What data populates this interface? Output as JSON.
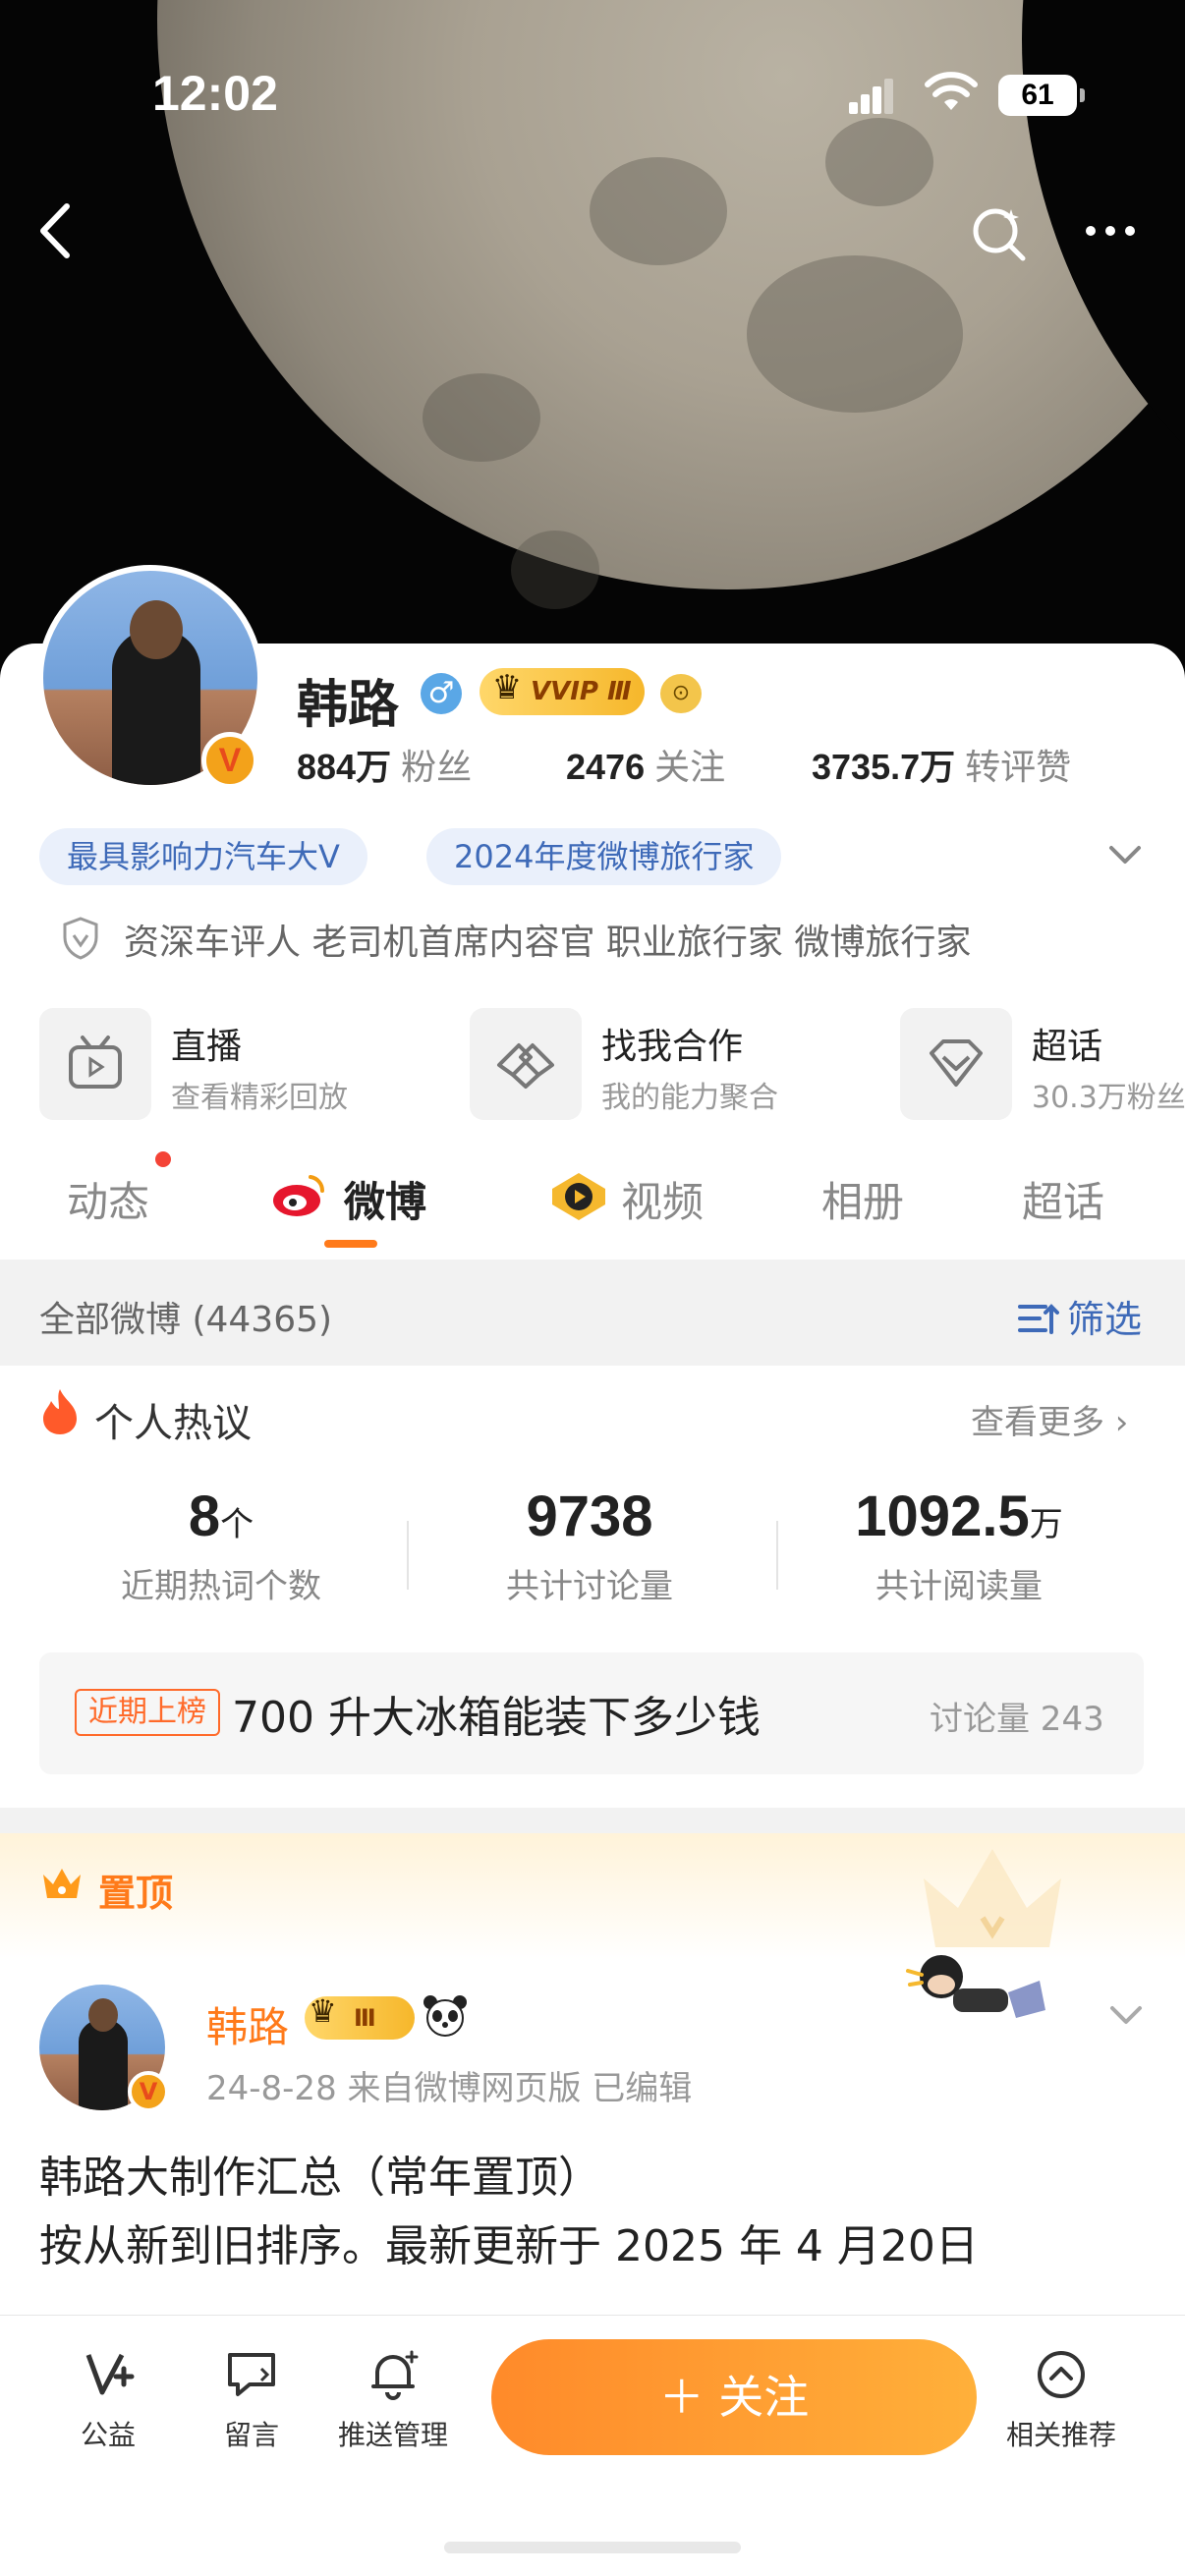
{
  "status_bar": {
    "time": "12:02",
    "battery": "61"
  },
  "profile": {
    "name": "韩路",
    "gender_symbol": "♂",
    "vip_badge": "VVIP Ⅲ",
    "verified_mark": "V",
    "stats": [
      {
        "value": "884万",
        "label": "粉丝"
      },
      {
        "value": "2476",
        "label": "关注"
      },
      {
        "value": "3735.7万",
        "label": "转评赞"
      }
    ],
    "tags": [
      "最具影响力汽车大V",
      "2024年度微博旅行家"
    ],
    "bio": "资深车评人 老司机首席内容官 职业旅行家 微博旅行家"
  },
  "features": [
    {
      "title": "直播",
      "subtitle": "查看精彩回放",
      "icon": "tv-icon"
    },
    {
      "title": "找我合作",
      "subtitle": "我的能力聚合",
      "icon": "handshake-icon"
    },
    {
      "title": "超话",
      "subtitle": "30.3万粉丝",
      "icon": "diamond-icon"
    }
  ],
  "tabs": [
    "动态",
    "微博",
    "视频",
    "相册",
    "超话"
  ],
  "active_tab": "微博",
  "filter": {
    "label": "全部微博 (44365)",
    "button": "筛选"
  },
  "hot": {
    "title": "个人热议",
    "more": "查看更多 ›",
    "metrics": [
      {
        "value": "8",
        "unit": "个",
        "label": "近期热词个数"
      },
      {
        "value": "9738",
        "unit": "",
        "label": "共计讨论量"
      },
      {
        "value": "1092.5",
        "unit": "万",
        "label": "共计阅读量"
      }
    ],
    "topic": {
      "badge": "近期上榜",
      "text": "700 升大冰箱能装下多少钱",
      "count": "讨论量 243"
    }
  },
  "pinned": {
    "label": "置顶",
    "author": "韩路",
    "badge": "Ⅲ",
    "meta": "24-8-28  来自微博网页版  已编辑",
    "line1": "韩路大制作汇总（常年置顶）",
    "line2": "按从新到旧排序。最新更新于 2025 年 4 月20日"
  },
  "bottom_bar": {
    "items": [
      {
        "label": "公益",
        "icon": "charity-v-icon"
      },
      {
        "label": "留言",
        "icon": "message-icon"
      },
      {
        "label": "推送管理",
        "icon": "bell-icon"
      },
      {
        "label": "相关推荐",
        "icon": "recommend-icon"
      }
    ],
    "follow": "＋ 关注"
  },
  "colors": {
    "accent": "#ff7a1a",
    "link": "#3e6ab8",
    "tag_bg": "#eaf0fb"
  }
}
